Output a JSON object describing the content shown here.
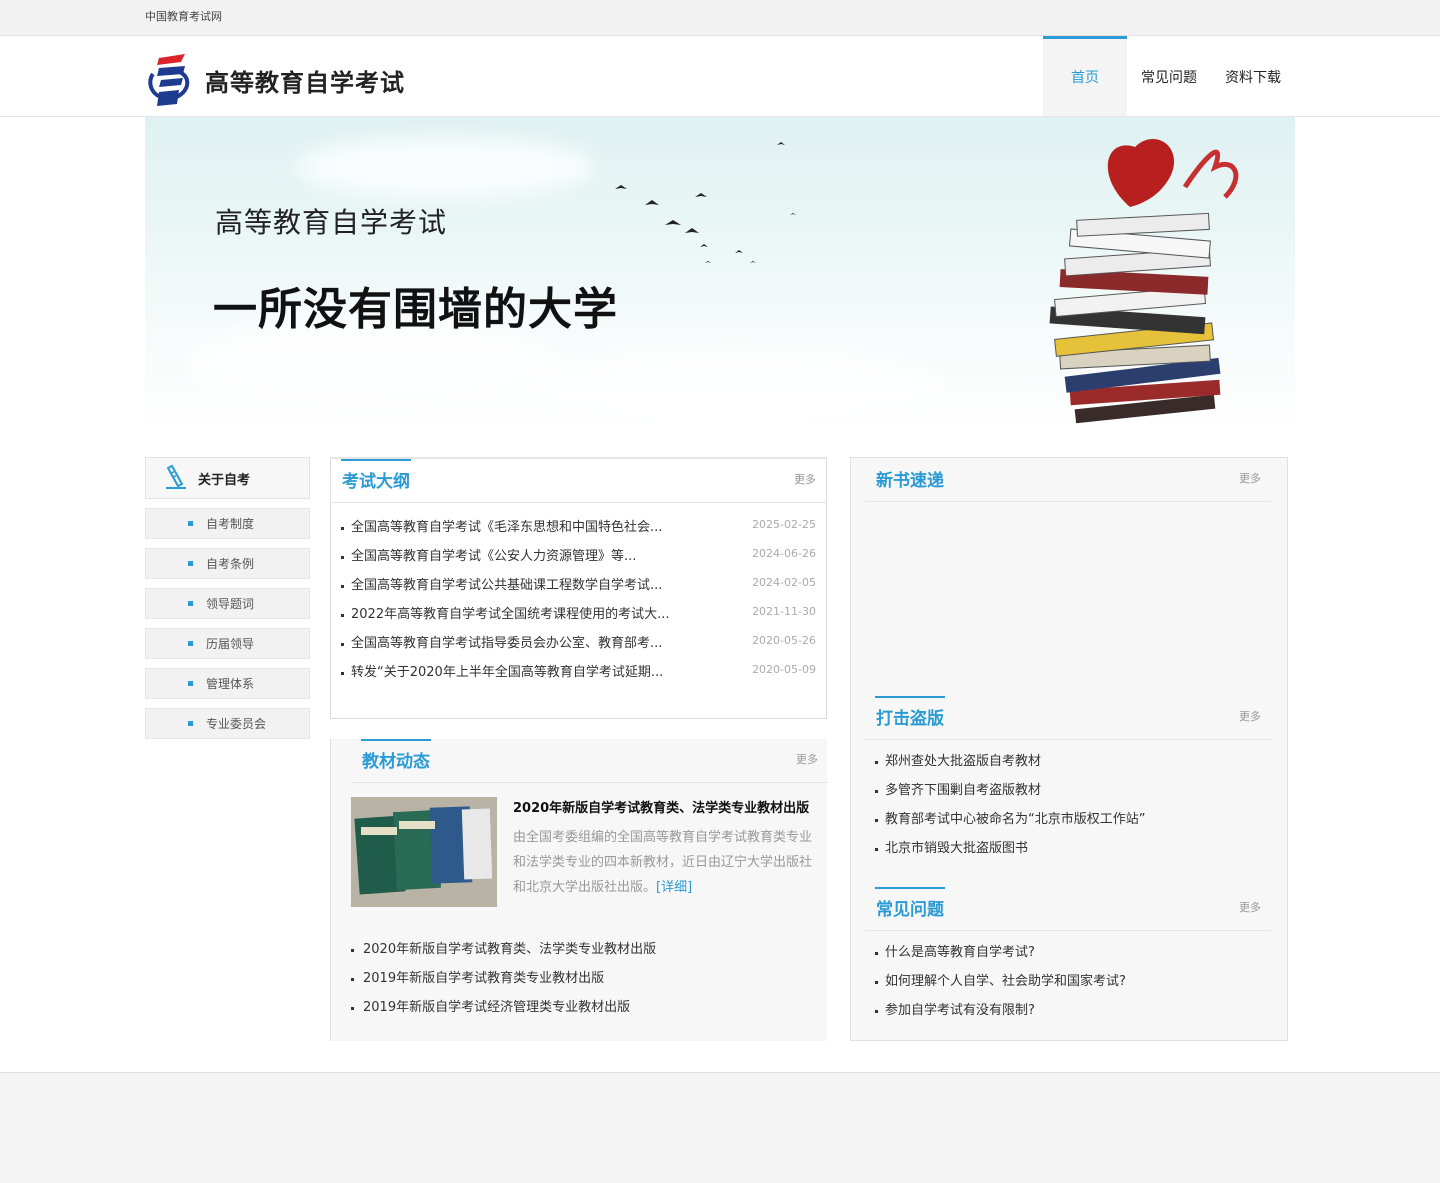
{
  "topbar": {
    "site_name": "中国教育考试网"
  },
  "header": {
    "title": "高等教育自学考试"
  },
  "nav": {
    "items": [
      "首页",
      "常见问题",
      "资料下载"
    ]
  },
  "banner": {
    "line1": "高等教育自学考试",
    "line2": "一所没有围墙的大学"
  },
  "sidebar": {
    "title": "关于自考",
    "items": [
      "自考制度",
      "自考条例",
      "领导题词",
      "历届领导",
      "管理体系",
      "专业委员会"
    ]
  },
  "syllabus": {
    "title": "考试大纲",
    "more": "更多",
    "items": [
      {
        "text": "全国高等教育自学考试《毛泽东思想和中国特色社会...",
        "date": "2025-02-25"
      },
      {
        "text": "全国高等教育自学考试《公安人力资源管理》等...",
        "date": "2024-06-26"
      },
      {
        "text": "全国高等教育自学考试公共基础课工程数学自学考试...",
        "date": "2024-02-05"
      },
      {
        "text": "2022年高等教育自学考试全国统考课程使用的考试大...",
        "date": "2021-11-30"
      },
      {
        "text": "全国高等教育自学考试指导委员会办公室、教育部考...",
        "date": "2020-05-26"
      },
      {
        "text": "转发“关于2020年上半年全国高等教育自学考试延期...",
        "date": "2020-05-09"
      }
    ]
  },
  "textbooks": {
    "title": "教材动态",
    "more": "更多",
    "feature_title": "2020年新版自学考试教育类、法学类专业教材出版",
    "feature_desc": "由全国考委组编的全国高等教育自学考试教育类专业和法学类专业的四本新教材，近日由辽宁大学出版社和北京大学出版社出版。",
    "detail_link": "[详细]",
    "items": [
      "2020年新版自学考试教育类、法学类专业教材出版",
      "2019年新版自学考试教育类专业教材出版",
      "2019年新版自学考试经济管理类专业教材出版"
    ]
  },
  "new_books": {
    "title": "新书速递",
    "more": "更多"
  },
  "anti_piracy": {
    "title": "打击盗版",
    "more": "更多",
    "items": [
      "郑州查处大批盗版自考教材",
      "多管齐下围剿自考盗版教材",
      "教育部考试中心被命名为“北京市版权工作站”",
      "北京市销毁大批盗版图书"
    ]
  },
  "faq": {
    "title": "常见问题",
    "more": "更多",
    "items": [
      "什么是高等教育自学考试?",
      "如何理解个人自学、社会助学和国家考试?",
      "参加自学考试有没有限制?"
    ]
  },
  "colors": {
    "accent": "#2a9bd4",
    "logo_red": "#d9252a",
    "logo_blue": "#1d3b8f"
  }
}
